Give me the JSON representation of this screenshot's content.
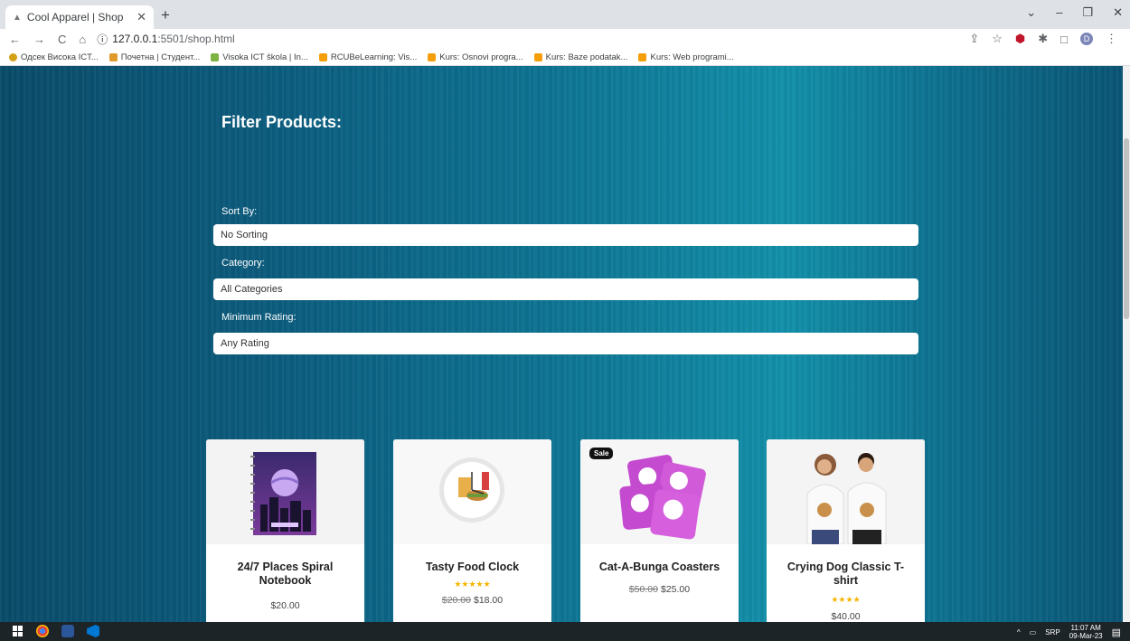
{
  "browser": {
    "tab_title": "Cool Apparel | Shop",
    "new_tab": "+",
    "url_host": "127.0.0.1",
    "url_path": ":5501/shop.html",
    "profile_initial": "D",
    "bookmarks": [
      {
        "label": "Одсек Висока ICT...",
        "color": "#d4a017"
      },
      {
        "label": "Почетна | Студент...",
        "color": "#e09a2b"
      },
      {
        "label": "Visoka ICT škola | In...",
        "color": "#7cb342"
      },
      {
        "label": "RCUBeLearning: Vis...",
        "color": "#f59e0b"
      },
      {
        "label": "Kurs: Osnovi progra...",
        "color": "#f59e0b"
      },
      {
        "label": "Kurs: Baze podatak...",
        "color": "#f59e0b"
      },
      {
        "label": "Kurs: Web programi...",
        "color": "#f59e0b"
      }
    ]
  },
  "filter": {
    "title": "Filter Products:",
    "sort_label": "Sort By:",
    "sort_value": "No Sorting",
    "category_label": "Category:",
    "category_value": "All Categories",
    "rating_label": "Minimum Rating:",
    "rating_value": "Any Rating"
  },
  "products": [
    {
      "name": "24/7 Places Spiral Notebook",
      "stars": "",
      "old_price": "",
      "price": "$20.00",
      "sale": ""
    },
    {
      "name": "Tasty Food Clock",
      "stars": "★★★★★",
      "old_price": "$20.00",
      "price": "$18.00",
      "sale": ""
    },
    {
      "name": "Cat-A-Bunga Coasters",
      "stars": "",
      "old_price": "$50.00",
      "price": "$25.00",
      "sale": "Sale"
    },
    {
      "name": "Crying Dog Classic T-shirt",
      "stars": "★★★★",
      "old_price": "",
      "price": "$40.00",
      "sale": ""
    }
  ],
  "taskbar": {
    "lang": "SRP",
    "time": "11:07 AM",
    "date": "09-Mar-23"
  }
}
